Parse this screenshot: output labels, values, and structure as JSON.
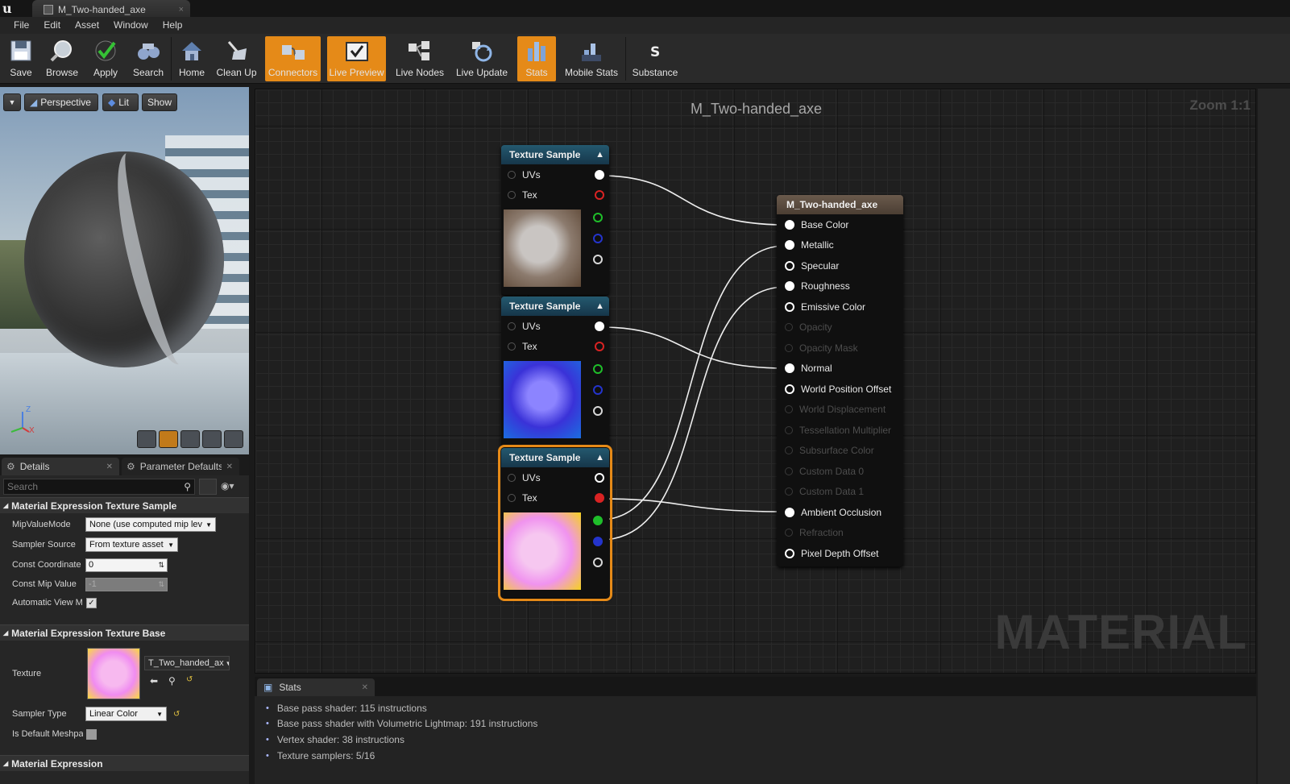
{
  "window": {
    "tab_title": "M_Two-handed_axe",
    "tab_close": "×"
  },
  "menu": [
    "File",
    "Edit",
    "Asset",
    "Window",
    "Help"
  ],
  "toolbar": [
    {
      "label": "Save",
      "icon": "save-icon",
      "active": false
    },
    {
      "label": "Browse",
      "icon": "browse-icon",
      "active": false
    },
    {
      "label": "Apply",
      "icon": "apply-checkmark-icon",
      "active": false
    },
    {
      "label": "Search",
      "icon": "search-binoculars-icon",
      "active": false
    },
    {
      "label": "Home",
      "icon": "home-icon",
      "active": false
    },
    {
      "label": "Clean Up",
      "icon": "clean-up-broom-icon",
      "active": false
    },
    {
      "label": "Connectors",
      "icon": "connectors-icon",
      "active": true
    },
    {
      "label": "Live Preview",
      "icon": "live-preview-icon",
      "active": true
    },
    {
      "label": "Live Nodes",
      "icon": "live-nodes-icon",
      "active": false
    },
    {
      "label": "Live Update",
      "icon": "live-update-icon",
      "active": false
    },
    {
      "label": "Stats",
      "icon": "stats-bars-icon",
      "active": true
    },
    {
      "label": "Mobile Stats",
      "icon": "mobile-stats-icon",
      "active": false
    },
    {
      "label": "Substance",
      "icon": "substance-icon",
      "active": false
    }
  ],
  "viewport": {
    "perspective": "Perspective",
    "lit": "Lit",
    "show": "Show",
    "axis_z": "Z",
    "axis_x": "X"
  },
  "details": {
    "tab_details": "Details",
    "tab_params": "Parameter Defaults",
    "search_placeholder": "Search",
    "cat_sample": "Material Expression Texture Sample",
    "mip_label": "MipValueMode",
    "mip_value": "None (use computed mip lev",
    "sampler_source_label": "Sampler Source",
    "sampler_source_value": "From texture asset",
    "const_coord_label": "Const Coordinate",
    "const_coord_value": "0",
    "const_mip_label": "Const Mip Value",
    "const_mip_value": "-1",
    "auto_view_label": "Automatic View M",
    "auto_view_checked": true,
    "cat_base": "Material Expression Texture Base",
    "texture_label": "Texture",
    "texture_value": "T_Two_handed_ax",
    "sampler_type_label": "Sampler Type",
    "sampler_type_value": "Linear Color",
    "default_mesh_label": "Is Default Meshpa",
    "default_mesh_checked": false,
    "cat_expr": "Material Expression"
  },
  "graph": {
    "title": "M_Two-handed_axe",
    "zoom": "Zoom 1:1",
    "watermark": "MATERIAL",
    "texture_nodes": [
      {
        "title": "Texture Sample",
        "uv": "UVs",
        "tex": "Tex",
        "selected": false,
        "thumb": "base-color-texture"
      },
      {
        "title": "Texture Sample",
        "uv": "UVs",
        "tex": "Tex",
        "selected": false,
        "thumb": "normal-map-texture"
      },
      {
        "title": "Texture Sample",
        "uv": "UVs",
        "tex": "Tex",
        "selected": true,
        "thumb": "orm-mask-texture"
      }
    ],
    "material_node": {
      "title": "M_Two-handed_axe",
      "inputs": [
        {
          "label": "Base Color",
          "enabled": true,
          "connected": true
        },
        {
          "label": "Metallic",
          "enabled": true,
          "connected": true
        },
        {
          "label": "Specular",
          "enabled": true,
          "connected": false
        },
        {
          "label": "Roughness",
          "enabled": true,
          "connected": true
        },
        {
          "label": "Emissive Color",
          "enabled": true,
          "connected": false
        },
        {
          "label": "Opacity",
          "enabled": false,
          "connected": false
        },
        {
          "label": "Opacity Mask",
          "enabled": false,
          "connected": false
        },
        {
          "label": "Normal",
          "enabled": true,
          "connected": true
        },
        {
          "label": "World Position Offset",
          "enabled": true,
          "connected": false
        },
        {
          "label": "World Displacement",
          "enabled": false,
          "connected": false
        },
        {
          "label": "Tessellation Multiplier",
          "enabled": false,
          "connected": false
        },
        {
          "label": "Subsurface Color",
          "enabled": false,
          "connected": false
        },
        {
          "label": "Custom Data 0",
          "enabled": false,
          "connected": false
        },
        {
          "label": "Custom Data 1",
          "enabled": false,
          "connected": false
        },
        {
          "label": "Ambient Occlusion",
          "enabled": true,
          "connected": true
        },
        {
          "label": "Refraction",
          "enabled": false,
          "connected": false
        },
        {
          "label": "Pixel Depth Offset",
          "enabled": true,
          "connected": false
        }
      ]
    }
  },
  "stats": {
    "tab": "Stats",
    "lines": [
      "Base pass shader: 115 instructions",
      "Base pass shader with Volumetric Lightmap: 191 instructions",
      "Vertex shader: 38 instructions",
      "Texture samplers: 5/16"
    ]
  },
  "colors": {
    "accent": "#e58a18",
    "node_header": "#1e4a60",
    "material_header": "#5c4d40"
  }
}
